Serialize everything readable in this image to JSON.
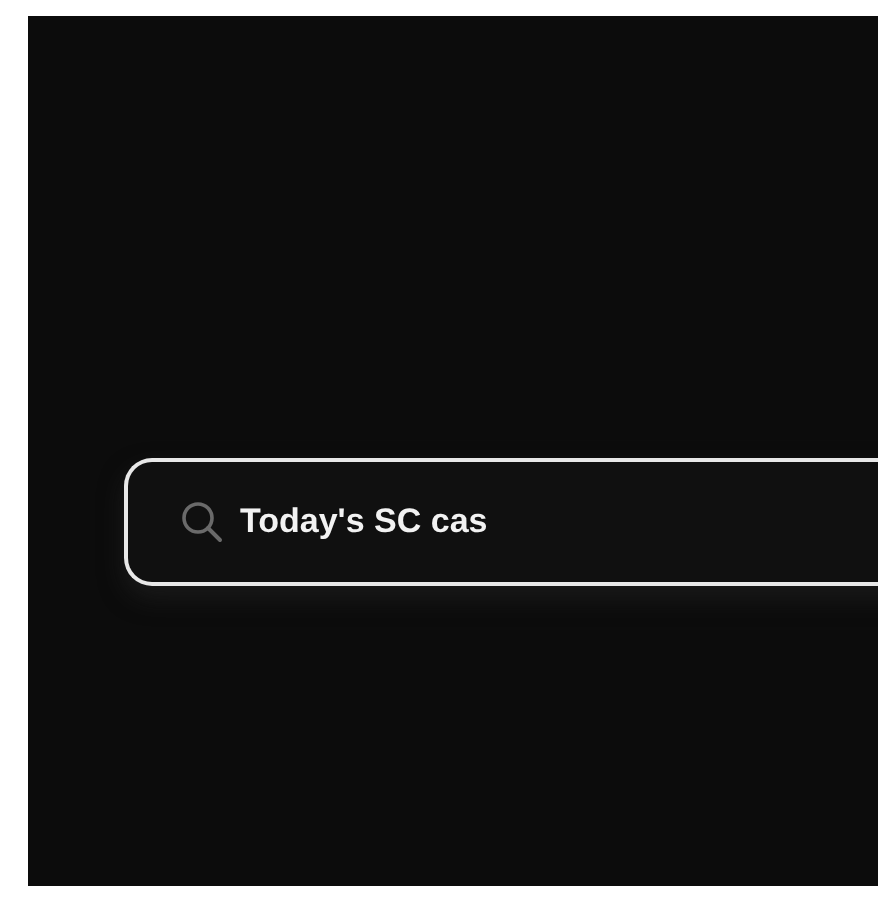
{
  "search": {
    "value": "Today's SC cas"
  }
}
